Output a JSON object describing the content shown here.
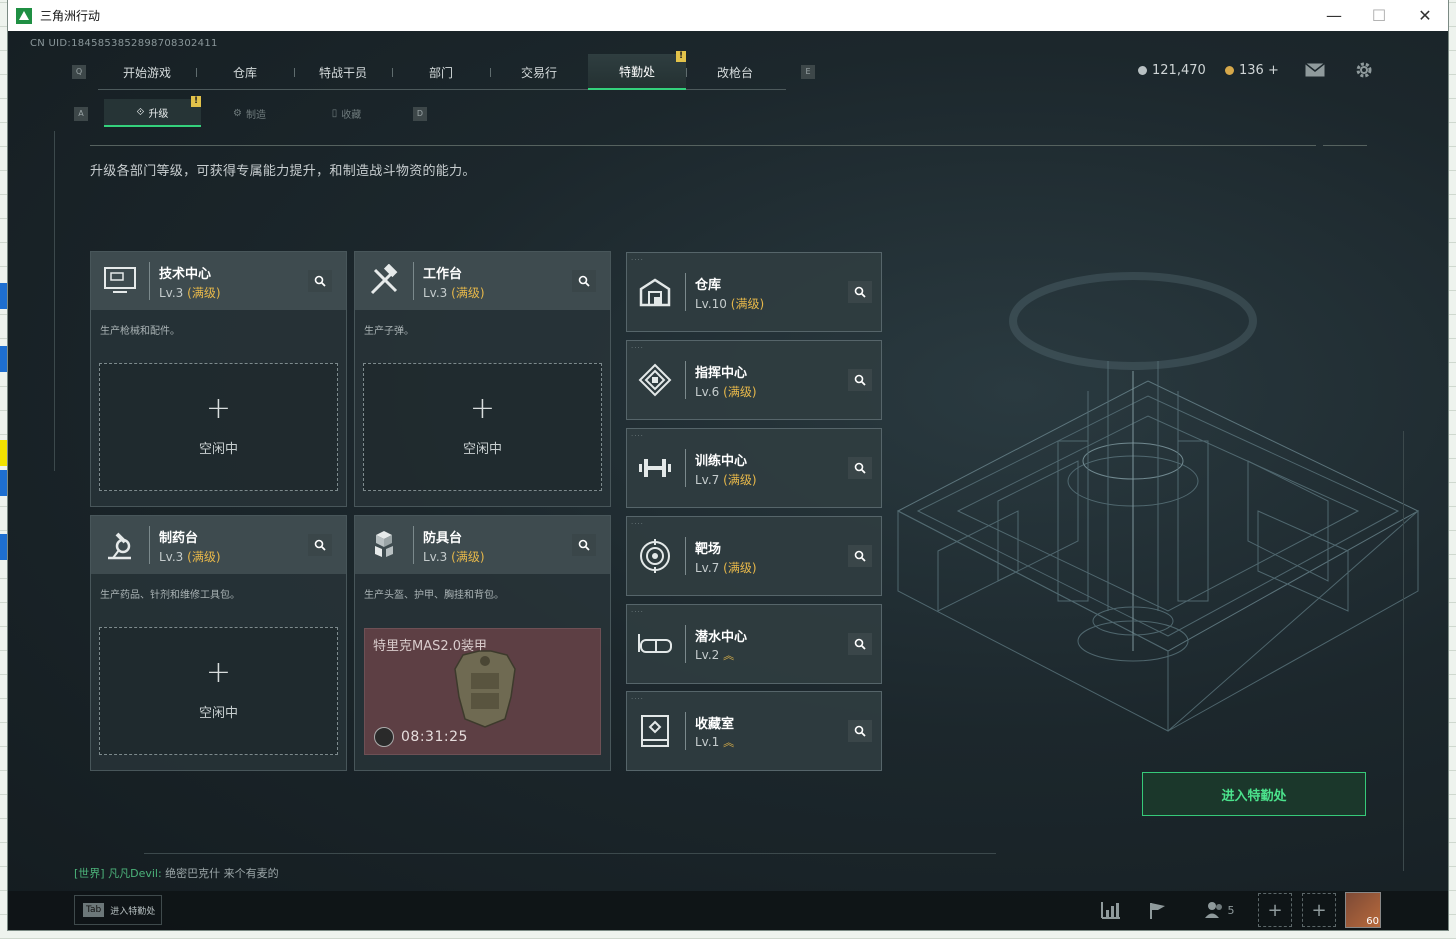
{
  "window": {
    "title": "三角洲行动",
    "minimize": "—",
    "maximize": "☐",
    "close": "✕"
  },
  "uid": "CN UID:1845853852898708302411",
  "nav": {
    "key_left": "Q",
    "key_right": "E",
    "tabs": [
      {
        "label": "开始游戏"
      },
      {
        "label": "仓库"
      },
      {
        "label": "特战干员"
      },
      {
        "label": "部门"
      },
      {
        "label": "交易行"
      },
      {
        "label": "特勤处",
        "active": true,
        "badge": "!"
      },
      {
        "label": "改枪台"
      }
    ]
  },
  "currency": {
    "silver": "121,470",
    "gold": "136 +"
  },
  "subnav": {
    "key_left": "A",
    "key_right": "D",
    "tabs": [
      {
        "label": "升级",
        "active": true,
        "badge": "!"
      },
      {
        "label": "制造"
      },
      {
        "label": "收藏"
      }
    ]
  },
  "description": "升级各部门等级，可获得专属能力提升，和制造战斗物资的能力。",
  "workbenches": [
    {
      "name": "技术中心",
      "level": "Lv.3",
      "max": "(满级)",
      "desc": "生产枪械和配件。",
      "icon": "computer-icon",
      "idle": "空闲中",
      "plus": "+"
    },
    {
      "name": "工作台",
      "level": "Lv.3",
      "max": "(满级)",
      "desc": "生产子弹。",
      "icon": "tools-icon",
      "idle": "空闲中",
      "plus": "+"
    },
    {
      "name": "制药台",
      "level": "Lv.3",
      "max": "(满级)",
      "desc": "生产药品、针剂和维修工具包。",
      "icon": "microscope-icon",
      "idle": "空闲中",
      "plus": "+"
    },
    {
      "name": "防具台",
      "level": "Lv.3",
      "max": "(满级)",
      "desc": "生产头盔、护甲、胸挂和背包。",
      "icon": "cubes-icon",
      "crafting_item": "特里克MAS2.0装甲",
      "timer": "08:31:25"
    }
  ],
  "departments": [
    {
      "name": "仓库",
      "level": "Lv.10",
      "max": "(满级)",
      "icon": "warehouse-icon"
    },
    {
      "name": "指挥中心",
      "level": "Lv.6",
      "max": "(满级)",
      "icon": "command-icon"
    },
    {
      "name": "训练中心",
      "level": "Lv.7",
      "max": "(满级)",
      "icon": "dumbbell-icon"
    },
    {
      "name": "靶场",
      "level": "Lv.7",
      "max": "(满级)",
      "icon": "target-icon"
    },
    {
      "name": "潜水中心",
      "level": "Lv.2",
      "max": "",
      "upgradable": "︽",
      "icon": "goggles-icon"
    },
    {
      "name": "收藏室",
      "level": "Lv.1",
      "max": "",
      "upgradable": "︽",
      "icon": "display-case-icon"
    }
  ],
  "enter_button": "进入特勤处",
  "chat": {
    "channel": "[世界]",
    "user": "凡凡Devil:",
    "message": "绝密巴克什  来个有麦的"
  },
  "bottom": {
    "tab_key": "Tab",
    "tab_label": "进入特勤处",
    "friends_count": "5",
    "avatar_level": "60"
  },
  "colors": {
    "accent_green": "#34d17c",
    "max_gold": "#e7b84a",
    "badge_yellow": "#e2c24a"
  }
}
